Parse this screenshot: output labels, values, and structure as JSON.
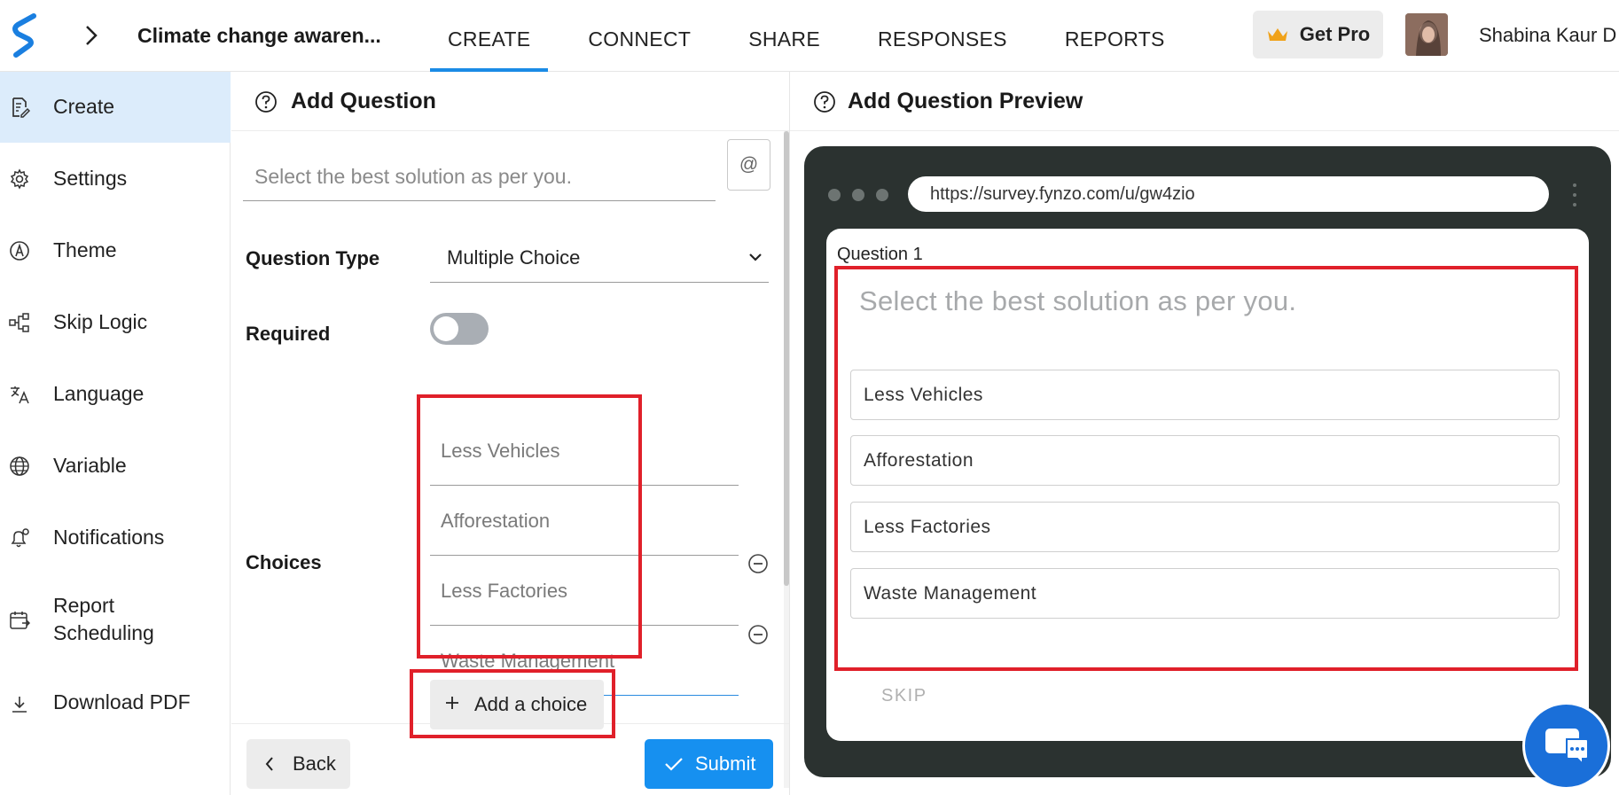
{
  "header": {
    "survey_title": "Climate change awaren...",
    "tabs": [
      {
        "label": "CREATE",
        "active": true
      },
      {
        "label": "CONNECT",
        "active": false
      },
      {
        "label": "SHARE",
        "active": false
      },
      {
        "label": "RESPONSES",
        "active": false
      },
      {
        "label": "REPORTS",
        "active": false
      }
    ],
    "get_pro_label": "Get Pro",
    "user_name": "Shabina Kaur D",
    "accent_color": "#1a8be6"
  },
  "sidebar": {
    "items": [
      {
        "label": "Create",
        "icon": "form-edit-icon",
        "active": true
      },
      {
        "label": "Settings",
        "icon": "gear-icon",
        "active": false
      },
      {
        "label": "Theme",
        "icon": "theme-icon",
        "active": false
      },
      {
        "label": "Skip Logic",
        "icon": "flow-icon",
        "active": false
      },
      {
        "label": "Language",
        "icon": "translate-icon",
        "active": false
      },
      {
        "label": "Variable",
        "icon": "globe-icon",
        "active": false
      },
      {
        "label": "Notifications",
        "icon": "bell-icon",
        "active": false
      },
      {
        "label": "Report Scheduling",
        "icon": "calendar-icon",
        "active": false
      },
      {
        "label": "Download PDF",
        "icon": "download-icon",
        "active": false
      }
    ]
  },
  "editor": {
    "title": "Add Question",
    "question_placeholder": "Select the best solution as per you.",
    "at_label": "@",
    "question_type_label": "Question Type",
    "question_type_value": "Multiple Choice",
    "required_label": "Required",
    "required_value": false,
    "choices_label": "Choices",
    "choices": [
      "Less Vehicles",
      "Afforestation",
      "Less Factories",
      "Waste Management"
    ],
    "add_choice_label": "Add a choice",
    "back_label": "Back",
    "submit_label": "Submit"
  },
  "preview": {
    "title": "Add Question Preview",
    "url": "https://survey.fynzo.com/u/gw4zio",
    "question_number": "Question 1",
    "question_text": "Select the best solution as per you.",
    "options": [
      "Less Vehicles",
      "Afforestation",
      "Less Factories",
      "Waste Management"
    ],
    "skip_label": "SKIP"
  },
  "colors": {
    "primary": "#1690f0",
    "highlight": "#e0202a",
    "device_frame": "#2b3230"
  }
}
